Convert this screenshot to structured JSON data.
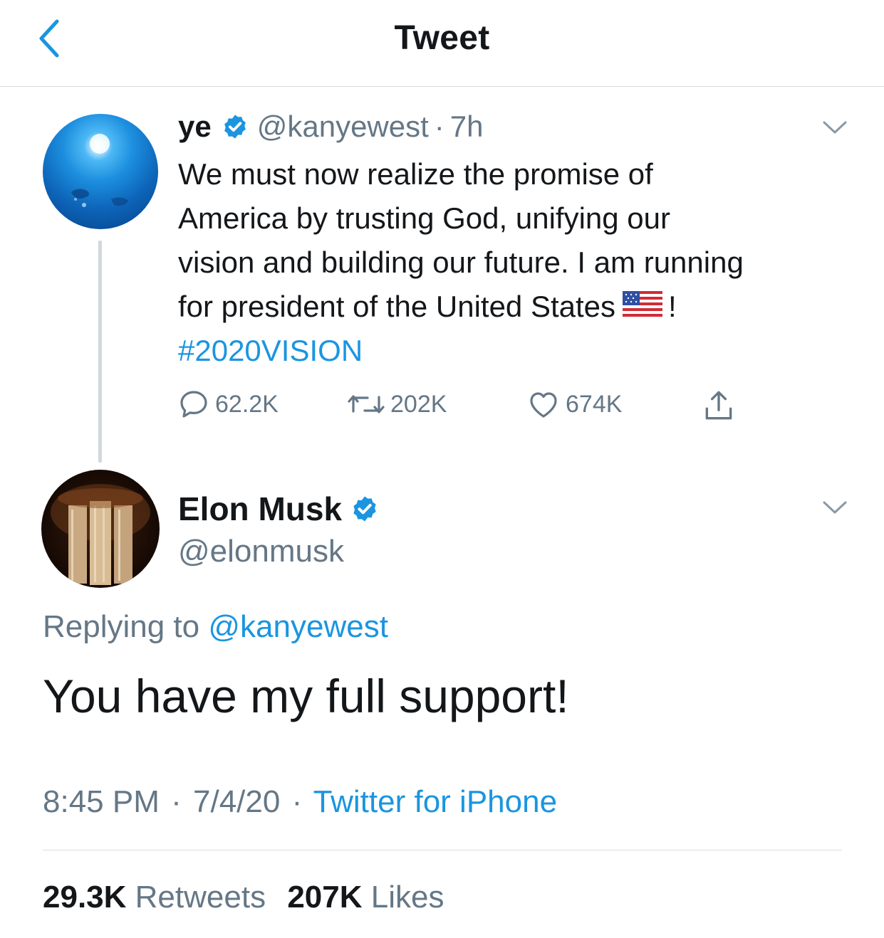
{
  "header": {
    "title": "Tweet",
    "back_icon": "chevron-left-icon"
  },
  "colors": {
    "accent": "#1b95e0",
    "text": "#14171a",
    "muted": "#657786",
    "divider": "#d9dde0"
  },
  "tweet_parent": {
    "display_name": "ye",
    "handle": "@kanyewest",
    "separator": "·",
    "age": "7h",
    "verified": true,
    "text_lines": [
      "We must now realize the promise of",
      "America by trusting God, unifying our",
      "vision and building our future. I am running",
      "for president of the United States"
    ],
    "trailing": "!",
    "hashtag": "#2020VISION",
    "actions": {
      "replies": "62.2K",
      "retweets": "202K",
      "likes": "674K"
    }
  },
  "tweet_main": {
    "display_name": "Elon Musk",
    "handle": "@elonmusk",
    "verified": true,
    "replying_prefix": "Replying to",
    "replying_to": "@kanyewest",
    "text": "You have my full support!",
    "time": "8:45 PM",
    "separator": "·",
    "date": "7/4/20",
    "source": "Twitter for iPhone",
    "retweets_count": "29.3K",
    "retweets_label": "Retweets",
    "likes_count": "207K",
    "likes_label": "Likes"
  }
}
